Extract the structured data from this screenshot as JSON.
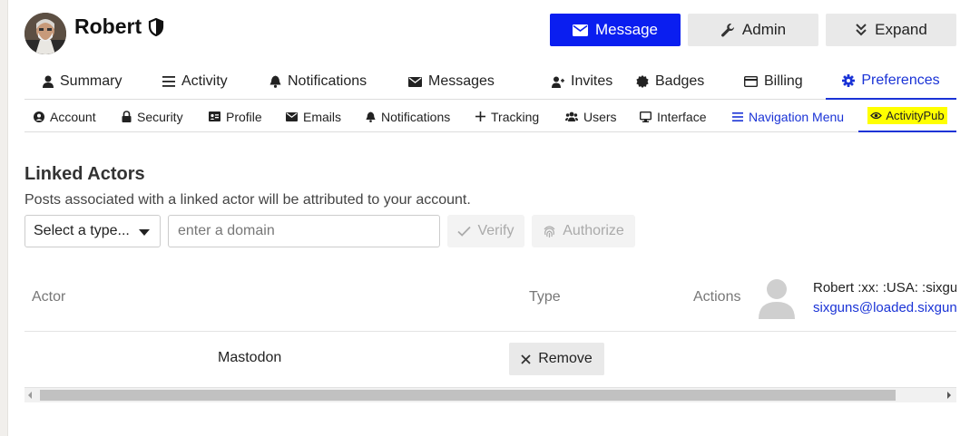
{
  "profile": {
    "name": "Robert",
    "badge_icon": "shield-half-icon"
  },
  "actions": {
    "message": "Message",
    "admin": "Admin",
    "expand": "Expand",
    "message_color": "#0a1ef0"
  },
  "primary_tabs": [
    {
      "label": "Summary",
      "icon": "user-icon"
    },
    {
      "label": "Activity",
      "icon": "list-icon"
    },
    {
      "label": "Notifications",
      "icon": "bell-icon"
    },
    {
      "label": "Messages",
      "icon": "envelope-icon"
    },
    {
      "label": "Invites",
      "icon": "user-plus-icon"
    },
    {
      "label": "Badges",
      "icon": "certificate-icon"
    },
    {
      "label": "Billing",
      "icon": "credit-card-icon"
    },
    {
      "label": "Preferences",
      "icon": "gear-icon",
      "active": true
    }
  ],
  "secondary_tabs": [
    {
      "label": "Account",
      "icon": "user-circle-icon"
    },
    {
      "label": "Security",
      "icon": "lock-icon"
    },
    {
      "label": "Profile",
      "icon": "id-card-icon"
    },
    {
      "label": "Emails",
      "icon": "envelope-icon"
    },
    {
      "label": "Notifications",
      "icon": "bell-icon"
    },
    {
      "label": "Tracking",
      "icon": "plus-icon"
    },
    {
      "label": "Users",
      "icon": "users-icon"
    },
    {
      "label": "Interface",
      "icon": "desktop-icon"
    },
    {
      "label": "Navigation Menu",
      "icon": "bars-icon"
    },
    {
      "label": "ActivityPub",
      "icon": "activitypub-icon",
      "active": true,
      "highlighted": true
    }
  ],
  "linked_actors": {
    "title": "Linked Actors",
    "description": "Posts associated with a linked actor will be attributed to your account.",
    "type_select": "Select a type...",
    "domain_placeholder": "enter a domain",
    "verify": "Verify",
    "authorize": "Authorize",
    "columns": {
      "actor": "Actor",
      "type": "Type",
      "actions": "Actions"
    },
    "rows": [
      {
        "type": "Mastodon",
        "action": "Remove"
      }
    ]
  },
  "user_card": {
    "name": "Robert :xx: :USA: :sixguns:",
    "handle": "sixguns@loaded.sixguns.social"
  }
}
